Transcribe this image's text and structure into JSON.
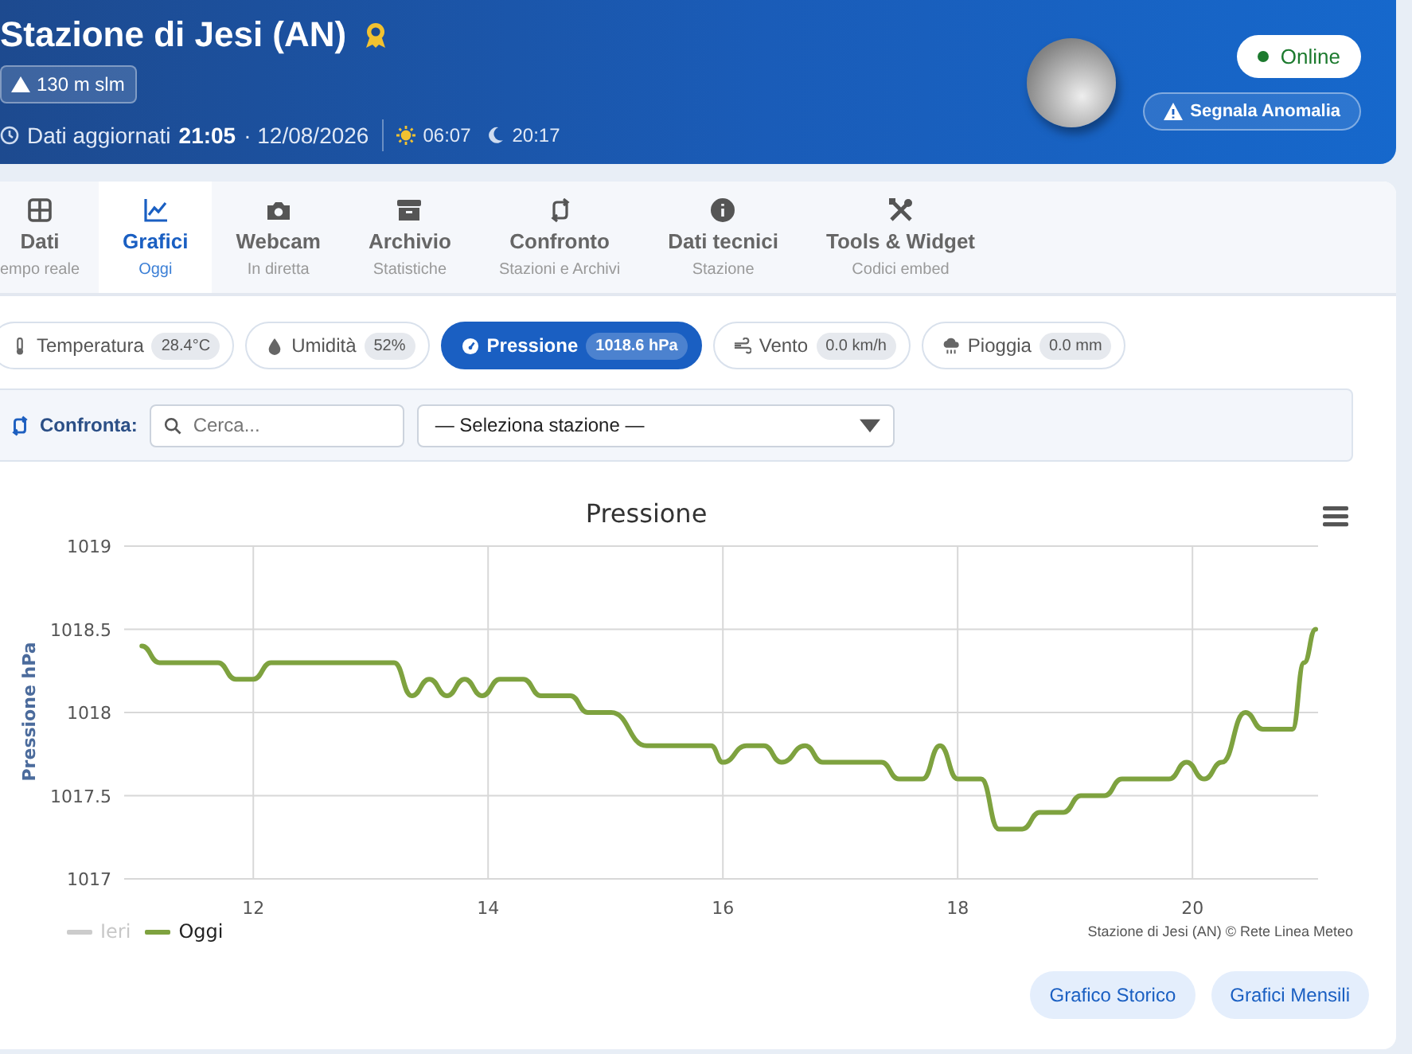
{
  "header": {
    "title": "Stazione di Jesi (AN)",
    "altitude": "130 m slm",
    "updated_label": "Dati aggiornati",
    "updated_time": "21:05",
    "updated_date": "· 12/08/2026",
    "sunrise": "06:07",
    "sunset": "20:17",
    "status": "Online",
    "report_button": "Segnala Anomalia"
  },
  "tabs": [
    {
      "label": "Dati",
      "sub": "empo reale",
      "selected": false
    },
    {
      "label": "Grafici",
      "sub": "Oggi",
      "selected": true
    },
    {
      "label": "Webcam",
      "sub": "In diretta",
      "selected": false
    },
    {
      "label": "Archivio",
      "sub": "Statistiche",
      "selected": false
    },
    {
      "label": "Confronto",
      "sub": "Stazioni e Archivi",
      "selected": false
    },
    {
      "label": "Dati tecnici",
      "sub": "Stazione",
      "selected": false
    },
    {
      "label": "Tools & Widget",
      "sub": "Codici embed",
      "selected": false
    }
  ],
  "metrics": [
    {
      "label": "Temperatura",
      "value": "28.4°C",
      "selected": false
    },
    {
      "label": "Umidità",
      "value": "52%",
      "selected": false
    },
    {
      "label": "Pressione",
      "value": "1018.6 hPa",
      "selected": true
    },
    {
      "label": "Vento",
      "value": "0.0 km/h",
      "selected": false
    },
    {
      "label": "Pioggia",
      "value": "0.0 mm",
      "selected": false
    }
  ],
  "compare": {
    "label": "Confronta:",
    "search_placeholder": "Cerca...",
    "station_select": "— Seleziona stazione —"
  },
  "chart": {
    "chart_data": {
      "type": "line",
      "grid": true,
      "title": "Pressione",
      "ylabel": "Pressione hPa",
      "xlim": [
        10.9,
        21.07
      ],
      "ylim": [
        1017,
        1019
      ],
      "xticks": [
        12,
        14,
        16,
        18,
        20
      ],
      "yticks": [
        1017,
        1017.5,
        1018,
        1018.5,
        1019
      ],
      "x": [
        11.05,
        11.2,
        11.7,
        11.85,
        12.0,
        12.15,
        13.2,
        13.35,
        13.5,
        13.65,
        13.8,
        13.95,
        14.1,
        14.3,
        14.45,
        14.7,
        14.85,
        15.05,
        15.35,
        15.9,
        16.0,
        16.2,
        16.35,
        16.5,
        16.7,
        16.85,
        17.35,
        17.5,
        17.7,
        17.85,
        18.0,
        18.2,
        18.35,
        18.55,
        18.7,
        18.9,
        19.05,
        19.25,
        19.4,
        19.8,
        19.95,
        20.1,
        20.25,
        20.45,
        20.6,
        20.85,
        20.95,
        21.05
      ],
      "series": [
        {
          "name": "Oggi",
          "color": "#7ea23f",
          "values": [
            1018.4,
            1018.3,
            1018.3,
            1018.2,
            1018.2,
            1018.3,
            1018.3,
            1018.1,
            1018.2,
            1018.1,
            1018.2,
            1018.1,
            1018.2,
            1018.2,
            1018.1,
            1018.1,
            1018.0,
            1018.0,
            1017.8,
            1017.8,
            1017.7,
            1017.8,
            1017.8,
            1017.7,
            1017.8,
            1017.7,
            1017.7,
            1017.6,
            1017.6,
            1017.8,
            1017.6,
            1017.6,
            1017.3,
            1017.3,
            1017.4,
            1017.4,
            1017.5,
            1017.5,
            1017.6,
            1017.6,
            1017.7,
            1017.6,
            1017.7,
            1018.0,
            1017.9,
            1017.9,
            1018.3,
            1018.5
          ]
        }
      ]
    },
    "hidden_legend": [
      {
        "label": "Ieri"
      }
    ],
    "credit": "Stazione di Jesi (AN) © Rete Linea Meteo"
  },
  "buttons": [
    "Grafico Storico",
    "Grafici Mensili"
  ]
}
